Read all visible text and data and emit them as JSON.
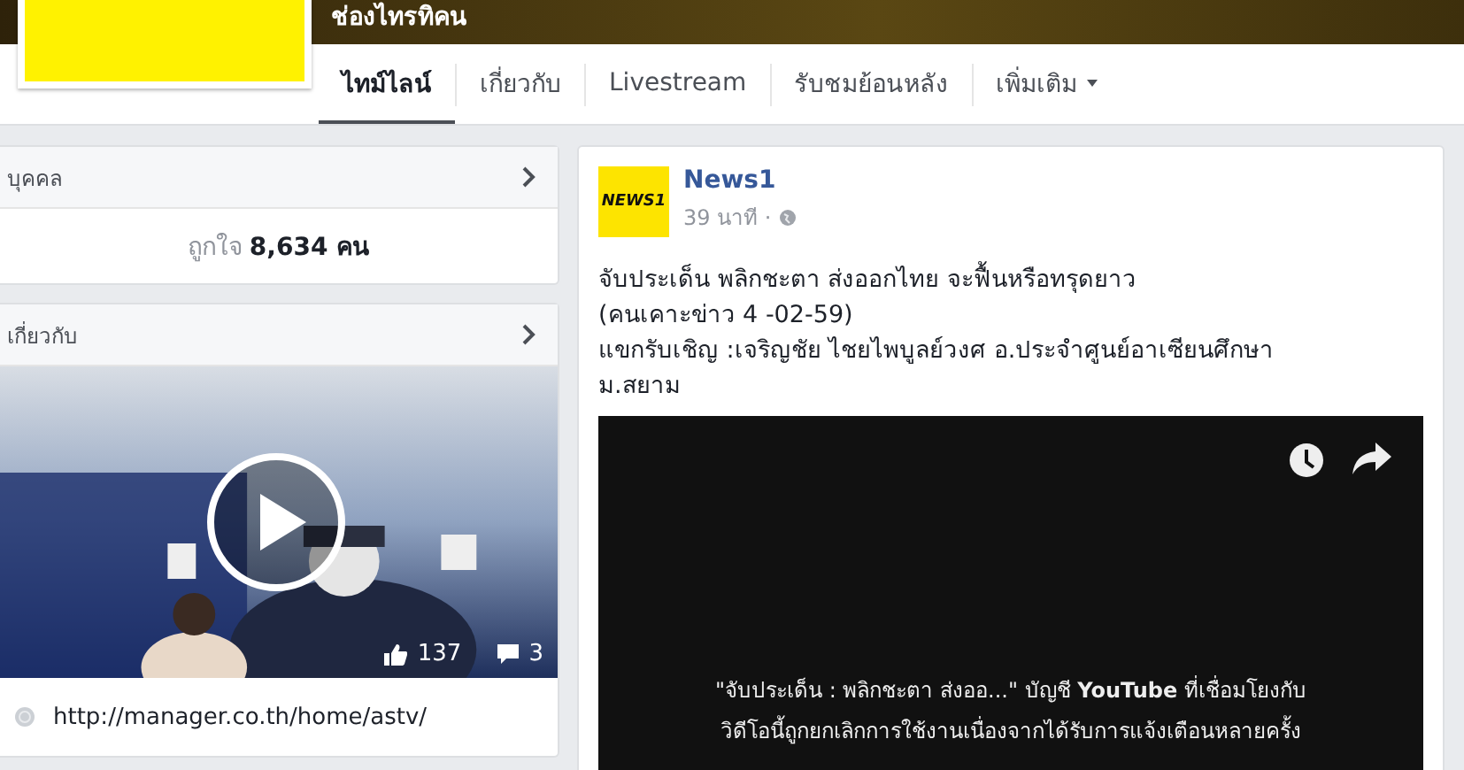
{
  "page": {
    "title": "ช่องไทรทิคน"
  },
  "tabs": [
    {
      "label": "ไทม์ไลน์",
      "selected": true
    },
    {
      "label": "เกี่ยวกับ",
      "selected": false
    },
    {
      "label": "Livestream",
      "selected": false
    },
    {
      "label": "รับชมย้อนหลัง",
      "selected": false
    },
    {
      "label": "เพิ่มเติม",
      "selected": false,
      "dropdown": true
    }
  ],
  "people_card": {
    "title": "บุคคล",
    "likes_label": "ถูกใจ",
    "likes_count": "8,634 คน"
  },
  "about_card": {
    "title": "เกี่ยวกับ",
    "video": {
      "kind": "picture",
      "likes": "137",
      "comments": "3"
    },
    "link": "http://manager.co.th/home/astv/"
  },
  "post": {
    "author": "News1",
    "avatar_text": "NEWS1",
    "time": "39 นาที ·",
    "lines": [
      "จับประเด็น พลิกชะตา ส่งออกไทย จะฟื้นหรือทรุดยาว",
      "(คนเคาะข่าว 4 -02-59)",
      "แขกรับเชิญ :เจริญชัย ไชยไพบูลย์วงศ อ.ประจำศูนย์อาเซียนศึกษา",
      "ม.สยาม"
    ],
    "video_notice": [
      "\"จับประเด็น : พลิกชะตา ส่งออ...\" บัญชี **YouTube** ที่เชื่อมโยงกับ",
      "วิดีโอนี้ถูกยกเลิกการใช้งานเนื่องจากได้รับการแจ้งเตือนหลายครั้ง"
    ]
  }
}
